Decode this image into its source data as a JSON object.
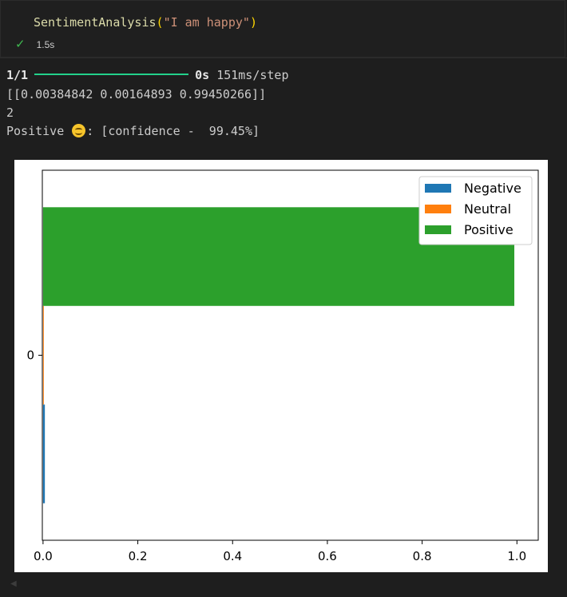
{
  "cell": {
    "code": {
      "function_name": "SentimentAnalysis",
      "open_paren": "(",
      "argument": "\"I am happy\"",
      "close_paren": ")"
    },
    "status": {
      "icon": "check-icon",
      "duration": "1.5s",
      "color": "#3fb950"
    }
  },
  "output": {
    "progress": {
      "step_count": "1/1",
      "fraction_complete": 1.0,
      "eta": "0s",
      "speed": "151ms/step",
      "bar_color": "#23d18b"
    },
    "probabilities_line": "[[0.00384842 0.00164893 0.99450266]]",
    "predicted_index_line": "2",
    "result_line": {
      "label": "Positive",
      "emoji_icon": "smiling-face-icon",
      "suffix": ": [confidence -  99.45%]"
    }
  },
  "chart_data": {
    "type": "bar",
    "orientation": "horizontal",
    "categories": [
      "0"
    ],
    "series": [
      {
        "name": "Negative",
        "values": [
          0.00384842
        ],
        "color": "#1f77b4"
      },
      {
        "name": "Neutral",
        "values": [
          0.00164893
        ],
        "color": "#ff7f0e"
      },
      {
        "name": "Positive",
        "values": [
          0.99450266
        ],
        "color": "#2ca02c"
      }
    ],
    "xlim": [
      -0.0015,
      1.045
    ],
    "xticks": [
      "0.0",
      "0.2",
      "0.4",
      "0.6",
      "0.8",
      "1.0"
    ],
    "xtick_values": [
      0,
      0.2,
      0.4,
      0.6,
      0.8,
      1.0
    ],
    "yticks": [
      "0"
    ],
    "title": "",
    "xlabel": "",
    "ylabel": "",
    "legend_position": "top-right",
    "grid": false
  }
}
